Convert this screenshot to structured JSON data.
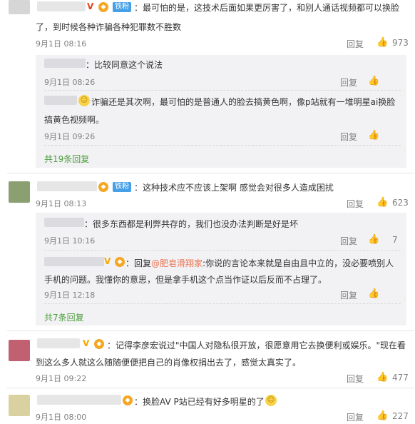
{
  "c1": {
    "fan_badge": "铁粉",
    "v_badge": "V",
    "line1": "：最可怕的是，这技术后面如果更厉害了，和别人通话视频都可以换脸",
    "line2": "了，到时候各种诈骗各种犯罪数不胜数",
    "time": "9月1日 08:16",
    "reply": "回复",
    "likes": "973",
    "r1": {
      "text": "：比较同意这个说法",
      "time": "9月1日 08:26",
      "reply": "回复"
    },
    "r2": {
      "line1a": "诈骗还是其次啊，最可怕的是普通人的脸去搞黄色啊，像p站就有一堆明星ai换脸",
      "line2": "搞黄色视频啊。",
      "time": "9月1日 09:26",
      "reply": "回复"
    },
    "more": "共19条回复"
  },
  "c2": {
    "fan_badge": "铁粉",
    "text": "：这种技术应不应该上架啊   感觉会对很多人造成困扰",
    "time": "9月1日 08:13",
    "reply": "回复",
    "likes": "623",
    "r1": {
      "text": "：很多东西都是利弊共存的，我们也没办法判断是好是坏",
      "time": "9月1日 10:16",
      "reply": "回复",
      "likes": "7"
    },
    "r2": {
      "pre": "：回复",
      "mention": "@肥皂滑翔家",
      "line1": ":你说的言论本来就是自由且中立的，没必要喷别人",
      "line2": "手机的问题。我懂你的意思，但是拿手机这个点当作证以后反而不占理了。",
      "time": "9月1日 12:18",
      "reply": "回复"
    },
    "more": "共7条回复"
  },
  "c3": {
    "line1": "：记得李彦宏说过\"中国人对隐私很开放，很愿意用它去换便利或娱乐。\"现在看",
    "line2": "到这么多人就这么随随便便把自己的肖像权捐出去了，感觉太真实了。",
    "time": "9月1日 09:22",
    "reply": "回复",
    "likes": "477"
  },
  "c4": {
    "text": "：换脸AV P站已经有好多明星的了",
    "time": "9月1日 08:00",
    "reply": "回复",
    "likes": "227"
  },
  "icons": {
    "like": "thumbs-up-icon",
    "emoji": "smiley-emoji"
  }
}
